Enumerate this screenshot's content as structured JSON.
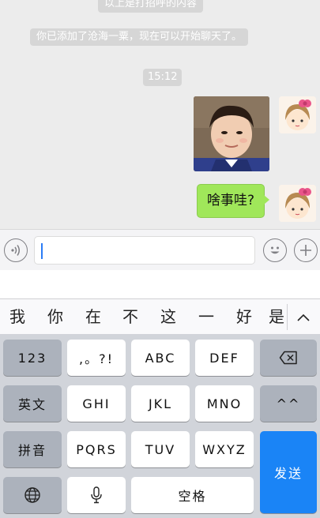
{
  "chat": {
    "system_top": "以上是打招呼的内容",
    "system_added": "你已添加了沧海一粟，现在可以开始聊天了。",
    "timestamp": "15:12",
    "text_message": "啥事哇?"
  },
  "input_bar": {
    "voice_icon": "voice-wave-icon",
    "emoji_icon": "smiley-icon",
    "plus_icon": "plus-icon",
    "input_value": ""
  },
  "candidates": {
    "items": [
      "我",
      "你",
      "在",
      "不",
      "这",
      "一",
      "好",
      "是"
    ],
    "expand_icon": "chevron-up-icon"
  },
  "keyboard": {
    "row1": [
      "123",
      ",。?!",
      "ABC",
      "DEF"
    ],
    "delete_icon": "backspace-icon",
    "row2": [
      "英文",
      "GHI",
      "JKL",
      "MNO",
      "^^"
    ],
    "row3": [
      "拼音",
      "PQRS",
      "TUV",
      "WXYZ"
    ],
    "send": "发送",
    "globe_icon": "globe-icon",
    "mic_icon": "microphone-icon",
    "space": "空格"
  },
  "colors": {
    "bubble": "#a0e75a",
    "send_key": "#1a84f6",
    "caret": "#2b7cf6"
  }
}
